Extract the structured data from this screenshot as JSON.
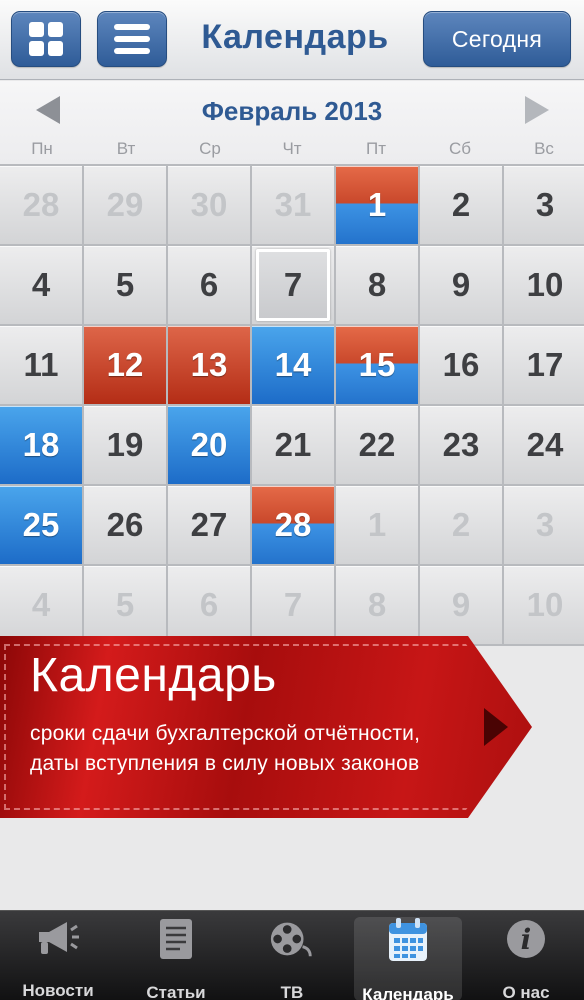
{
  "header": {
    "title": "Календарь",
    "today_button": "Сегодня"
  },
  "calendar": {
    "month_title": "Февраль 2013",
    "weekdays": [
      "Пн",
      "Вт",
      "Ср",
      "Чт",
      "Пт",
      "Сб",
      "Вс"
    ],
    "selected_day": 7,
    "weeks": [
      [
        {
          "day": "28",
          "state": "other"
        },
        {
          "day": "29",
          "state": "other"
        },
        {
          "day": "30",
          "state": "other"
        },
        {
          "day": "31",
          "state": "other"
        },
        {
          "day": "1",
          "state": "split"
        },
        {
          "day": "2",
          "state": "normal"
        },
        {
          "day": "3",
          "state": "normal"
        }
      ],
      [
        {
          "day": "4",
          "state": "normal"
        },
        {
          "day": "5",
          "state": "normal"
        },
        {
          "day": "6",
          "state": "normal"
        },
        {
          "day": "7",
          "state": "today"
        },
        {
          "day": "8",
          "state": "normal"
        },
        {
          "day": "9",
          "state": "normal"
        },
        {
          "day": "10",
          "state": "normal"
        }
      ],
      [
        {
          "day": "11",
          "state": "normal"
        },
        {
          "day": "12",
          "state": "red"
        },
        {
          "day": "13",
          "state": "red"
        },
        {
          "day": "14",
          "state": "blue"
        },
        {
          "day": "15",
          "state": "split"
        },
        {
          "day": "16",
          "state": "normal"
        },
        {
          "day": "17",
          "state": "normal"
        }
      ],
      [
        {
          "day": "18",
          "state": "blue"
        },
        {
          "day": "19",
          "state": "normal"
        },
        {
          "day": "20",
          "state": "blue"
        },
        {
          "day": "21",
          "state": "normal"
        },
        {
          "day": "22",
          "state": "normal"
        },
        {
          "day": "23",
          "state": "normal"
        },
        {
          "day": "24",
          "state": "normal"
        }
      ],
      [
        {
          "day": "25",
          "state": "blue"
        },
        {
          "day": "26",
          "state": "normal"
        },
        {
          "day": "27",
          "state": "normal"
        },
        {
          "day": "28",
          "state": "split"
        },
        {
          "day": "1",
          "state": "other"
        },
        {
          "day": "2",
          "state": "other"
        },
        {
          "day": "3",
          "state": "other"
        }
      ],
      [
        {
          "day": "4",
          "state": "other"
        },
        {
          "day": "5",
          "state": "other"
        },
        {
          "day": "6",
          "state": "other"
        },
        {
          "day": "7",
          "state": "other"
        },
        {
          "day": "8",
          "state": "other"
        },
        {
          "day": "9",
          "state": "other"
        },
        {
          "day": "10",
          "state": "other"
        }
      ]
    ]
  },
  "banner": {
    "title": "Календарь",
    "line1": "сроки сдачи бухгалтерской отчётности,",
    "line2": "даты вступления в силу новых законов"
  },
  "tabs": [
    {
      "label": "Новости",
      "icon": "megaphone-icon"
    },
    {
      "label": "Статьи",
      "icon": "document-icon"
    },
    {
      "label": "ТВ",
      "icon": "film-reel-icon"
    },
    {
      "label": "Календарь",
      "icon": "calendar-icon",
      "active": true
    },
    {
      "label": "О нас",
      "icon": "info-icon"
    }
  ],
  "colors": {
    "accent_blue": "#2f5a93",
    "event_red": "#c43a20",
    "event_blue": "#2d86dc",
    "banner_red": "#c01515"
  }
}
